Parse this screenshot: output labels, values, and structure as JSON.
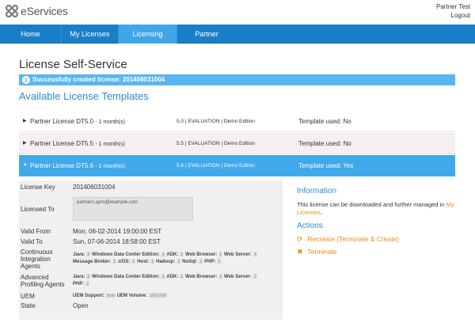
{
  "app": {
    "brand": "eServices",
    "user": "Partner Test",
    "logout": "Logout"
  },
  "nav": [
    {
      "label": "Home"
    },
    {
      "label": "My Licenses"
    },
    {
      "label": "Licensing"
    },
    {
      "label": "Partner"
    }
  ],
  "page": {
    "title": "License Self-Service",
    "success": "Successfully created license: 201406031004",
    "section_title": "Available License Templates"
  },
  "templates": [
    {
      "name": "Partner License DT5.0",
      "term": "- 1 month(s)",
      "info": "5.0 | EVALUATION | Demo Edition",
      "used": "Template used: No"
    },
    {
      "name": "Partner License DT5.5",
      "term": "- 1 month(s)",
      "info": "5.5 | EVALUATION | Demo Edition",
      "used": "Template used: No"
    },
    {
      "name": "Partner License DT5.6",
      "term": "- 1 month(s)",
      "info": "5.6 | EVALUATION | Demo Edition",
      "used": "Template used: Yes"
    }
  ],
  "details": {
    "license_key_label": "License Key",
    "license_key": "201406031004",
    "licensed_to_label": "Licensed To",
    "licensed_to": "partners.apm@example.com",
    "valid_from_label": "Valid From",
    "valid_from": "Mon, 06-02-2014 19:00:00 EST",
    "valid_to_label": "Valid To",
    "valid_to": "Sun, 07-06-2014 18:58:00 EST",
    "ci_label": "Continuous Integration Agents",
    "ci_line1": {
      "java": "Java:",
      "java_v": "3",
      "win": "Windows Data Center Edition:",
      "win_v": "1",
      "adk": "ADK:",
      "adk_v": "1",
      "wb": "Web Browser:",
      "wb_v": "1",
      "ws": "Web Server:",
      "ws_v": "3"
    },
    "ci_line2": {
      "mb": "Message Broker:",
      "mb_v": "1",
      "zos": "z/OS:",
      "zos_v": "1",
      "host": "Host:",
      "host_v": "1",
      "hadoop": "Hadoop:",
      "hadoop_v": "2",
      "nosql": "NoSql:",
      "nosql_v": "2",
      "php": "PHP:",
      "php_v": "2"
    },
    "ap_label": "Advanced Profiling Agents",
    "ap_line1": {
      "java": "Java:",
      "java_v": "3",
      "win": "Windows Data Center Edition:",
      "win_v": "1",
      "adk": "ADK:",
      "adk_v": "1",
      "wb": "Web Browser:",
      "wb_v": "1",
      "ws": "Web Server:",
      "ws_v": "2"
    },
    "ap_line2": {
      "php": "PHP:",
      "php_v": "2"
    },
    "uem_label": "UEM",
    "uem": {
      "support": "UEM Support:",
      "support_v": "true",
      "volume": "UEM Volume:",
      "volume_v": "100,000"
    },
    "state_label": "State",
    "state": "Open"
  },
  "information": {
    "title": "Information",
    "text": "This license can be downloaded and further managed in",
    "link": "My Licenses",
    "after": "."
  },
  "actions": {
    "title": "Actions",
    "recreate": "Recreate (Terminate & Create)",
    "terminate": "Terminate"
  }
}
